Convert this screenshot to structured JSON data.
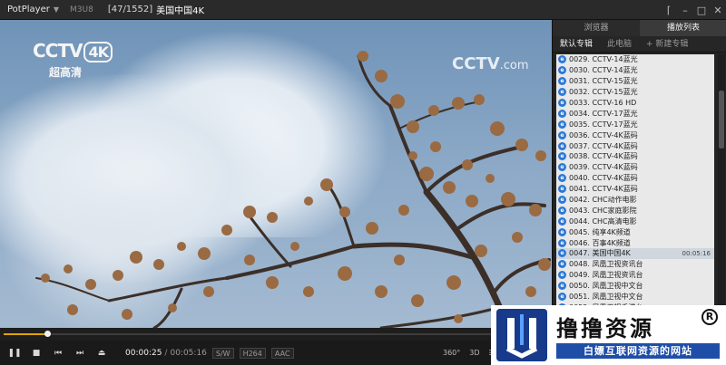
{
  "titlebar": {
    "app_name": "PotPlayer",
    "format": "M3U8",
    "counter": "[47/1552]",
    "now_title": "美国中国4K",
    "controls": [
      "pin-icon",
      "minimize-icon",
      "maximize-icon",
      "close-icon"
    ]
  },
  "video": {
    "logo_brand": "CCTV",
    "logo_4k": "4K",
    "logo_sub": "超高清",
    "watermark_main": "CCTV",
    "watermark_com": ".com"
  },
  "playback": {
    "progress": 0.08,
    "current_time": "00:00:25",
    "separator": "/",
    "total_time": "00:05:16",
    "tags": [
      "S/W",
      "H264",
      "AAC"
    ],
    "right_controls": [
      "360°",
      "3D",
      "playlist-icon"
    ]
  },
  "panel": {
    "tabs": [
      {
        "label": "浏览器",
        "active": false
      },
      {
        "label": "播放列表",
        "active": true
      }
    ],
    "subtabs": [
      {
        "label": "默认专辑",
        "active": true
      },
      {
        "label": "此电脑",
        "active": false
      },
      {
        "label": "+ 新建专辑",
        "active": false
      }
    ],
    "items": [
      {
        "label": "0029. CCTV-14蓝光",
        "duration": ""
      },
      {
        "label": "0030. CCTV-14蓝光",
        "duration": ""
      },
      {
        "label": "0031. CCTV-15蓝光",
        "duration": ""
      },
      {
        "label": "0032. CCTV-15蓝光",
        "duration": ""
      },
      {
        "label": "0033. CCTV-16 HD",
        "duration": ""
      },
      {
        "label": "0034. CCTV-17蓝光",
        "duration": ""
      },
      {
        "label": "0035. CCTV-17蓝光",
        "duration": ""
      },
      {
        "label": "0036. CCTV-4K蓝码",
        "duration": ""
      },
      {
        "label": "0037. CCTV-4K蓝码",
        "duration": ""
      },
      {
        "label": "0038. CCTV-4K蓝码",
        "duration": ""
      },
      {
        "label": "0039. CCTV-4K蓝码",
        "duration": ""
      },
      {
        "label": "0040. CCTV-4K蓝码",
        "duration": ""
      },
      {
        "label": "0041. CCTV-4K蓝码",
        "duration": ""
      },
      {
        "label": "0042. CHC动作电影",
        "duration": ""
      },
      {
        "label": "0043. CHC家庭影院",
        "duration": ""
      },
      {
        "label": "0044. CHC高清电影",
        "duration": ""
      },
      {
        "label": "0045. 纯享4K频道",
        "duration": ""
      },
      {
        "label": "0046. 百事4K频道",
        "duration": ""
      },
      {
        "label": "0047. 美国中国4K",
        "duration": "00:05:16",
        "current": true
      },
      {
        "label": "0048. 凤凰卫视资讯台",
        "duration": ""
      },
      {
        "label": "0049. 凤凰卫视资讯台",
        "duration": ""
      },
      {
        "label": "0050. 凤凰卫视中文台",
        "duration": ""
      },
      {
        "label": "0051. 凤凰卫视中文台",
        "duration": ""
      },
      {
        "label": "0052. 凤凰卫视香港台",
        "duration": ""
      },
      {
        "label": "0053. 凤凰卫视香港台",
        "duration": ""
      }
    ]
  },
  "promo": {
    "title": "撸撸资源",
    "reg_mark": "R",
    "subtitle": "白嫖互联网资源的网站"
  }
}
